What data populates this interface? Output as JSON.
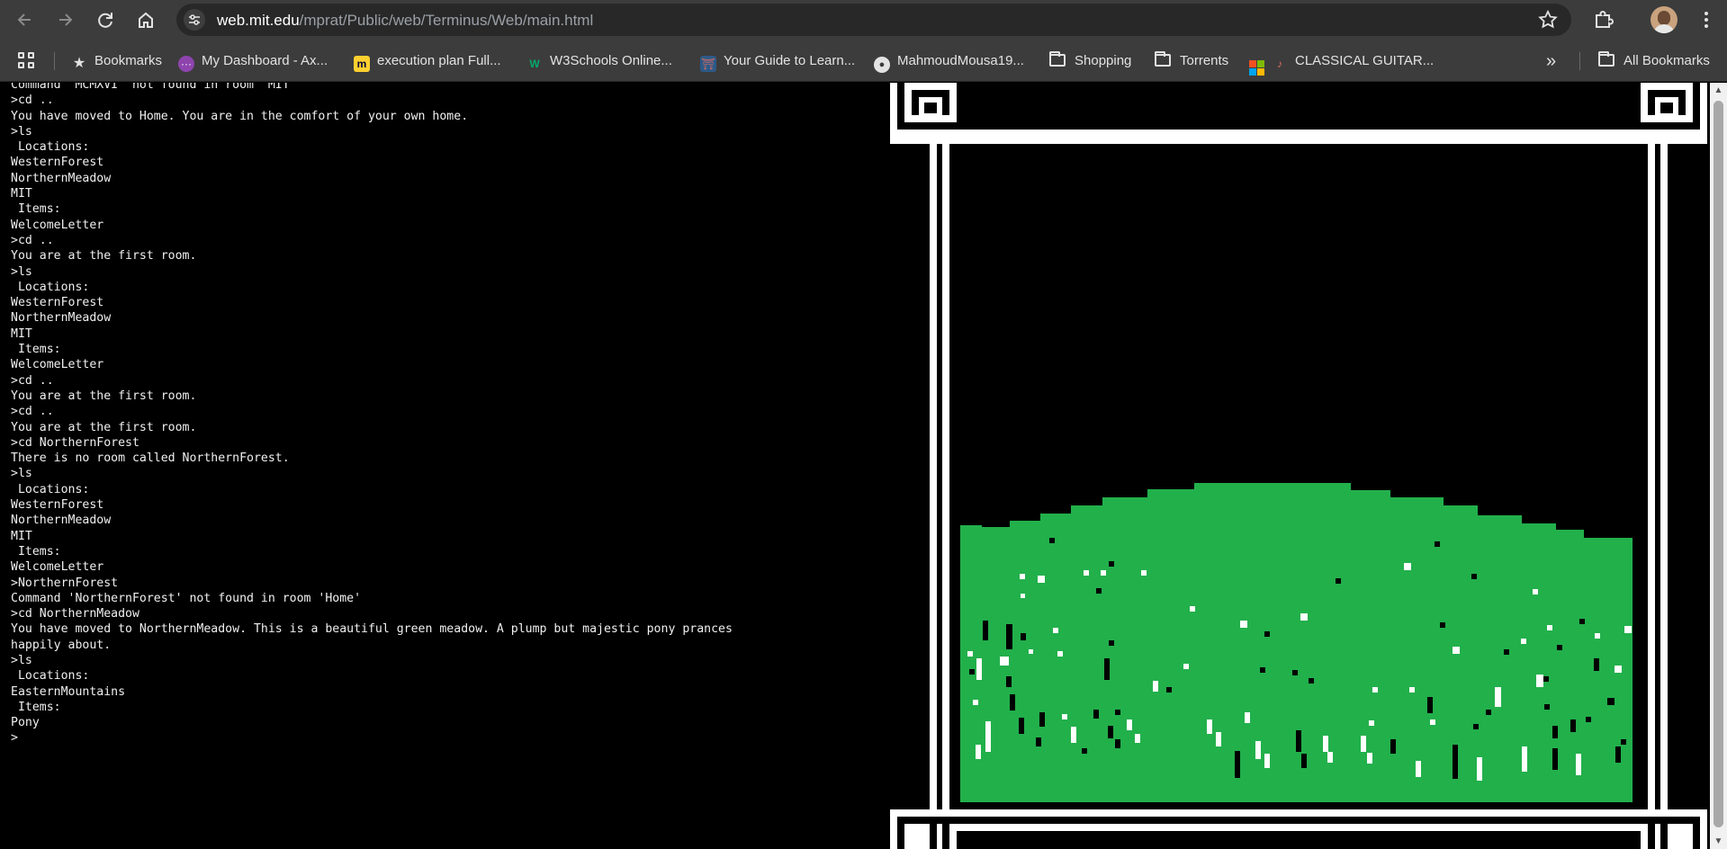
{
  "browser": {
    "url_host": "web.mit.edu",
    "url_path": "/mprat/Public/web/Terminus/Web/main.html",
    "icons": {
      "back": "arrow-left-icon",
      "forward": "arrow-right-icon",
      "reload": "reload-icon",
      "home": "home-icon",
      "site_info": "tune-icon",
      "bookmark_star": "star-icon",
      "extensions": "puzzle-icon",
      "menu": "kebab-menu-icon"
    }
  },
  "bookmarks_bar": {
    "items": [
      {
        "label": "Bookmarks",
        "icon": "star-icon"
      },
      {
        "label": "My Dashboard - Ax...",
        "icon": "dots-circle-icon",
        "color": "#8e44ad"
      },
      {
        "label": "execution plan Full...",
        "icon": "miro-icon",
        "color": "#ffd02f"
      },
      {
        "label": "W3Schools Online...",
        "icon": "w3schools-icon",
        "color": "#04aa6d"
      },
      {
        "label": "Your Guide to Learn...",
        "icon": "torii-icon",
        "color": "#e06c5f"
      },
      {
        "label": "MahmoudMousa19...",
        "icon": "github-icon"
      },
      {
        "label": "Shopping",
        "icon": "folder-icon"
      },
      {
        "label": "Torrents",
        "icon": "folder-icon"
      },
      {
        "label": "CLASSICAL GUITAR...",
        "icon": "guitar-icon"
      }
    ],
    "overflow": "»",
    "all_bookmarks": "All Bookmarks"
  },
  "terminal": {
    "lines": [
      "Command 'MCMXVI' not found in room 'MIT'",
      ">cd ..",
      "You have moved to Home. You are in the comfort of your own home.",
      ">ls",
      " Locations:",
      "WesternForest",
      "NorthernMeadow",
      "MIT",
      " Items:",
      "WelcomeLetter",
      ">cd ..",
      "You are at the first room.",
      ">ls",
      " Locations:",
      "WesternForest",
      "NorthernMeadow",
      "MIT",
      " Items:",
      "WelcomeLetter",
      ">cd ..",
      "You are at the first room.",
      ">cd ..",
      "You are at the first room.",
      ">cd NorthernForest",
      "There is no room called NorthernForest.",
      ">ls",
      " Locations:",
      "WesternForest",
      "NorthernMeadow",
      "MIT",
      " Items:",
      "WelcomeLetter",
      ">NorthernForest",
      "Command 'NorthernForest' not found in room 'Home'",
      ">cd NorthernMeadow",
      "You have moved to NorthernMeadow. This is a beautiful green meadow. A plump but majestic pony prances",
      "happily about.",
      ">ls",
      " Locations:",
      "EasternMountains",
      " Items:",
      "Pony",
      ">"
    ]
  },
  "scene": {
    "subject": "meadow-pixel-art",
    "colors": {
      "grass": "#22b04b",
      "frame": "#ffffff",
      "background": "#000000"
    }
  }
}
